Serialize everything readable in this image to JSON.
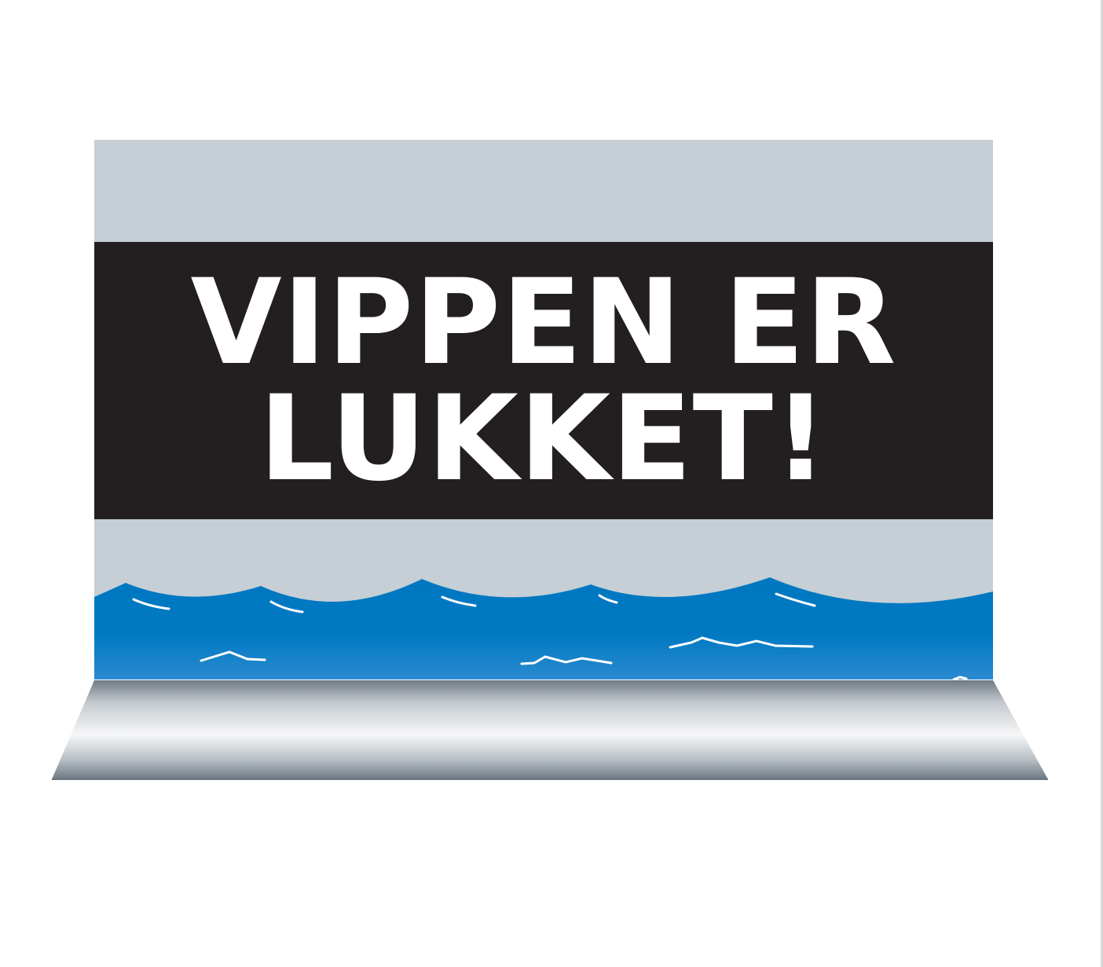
{
  "sign": {
    "line1": "VIPPEN ER",
    "line2": "LUKKET!"
  },
  "colors": {
    "background": "#ffffff",
    "sky": "#c5cfd5",
    "banner": "#231f20",
    "text": "#ffffff",
    "water_top": "#0078c1",
    "water_bottom": "#2b8ad0",
    "foam": "#ffffff",
    "board_light": "#f4f5f6",
    "board_dark": "#7b8690"
  },
  "icons": {
    "water": "water-waves-icon",
    "board": "diving-board-icon"
  }
}
